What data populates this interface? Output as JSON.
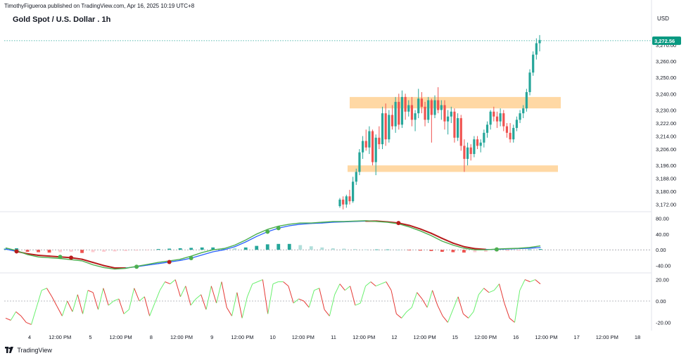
{
  "header": {
    "published": "TimothyFigueroa published on TradingView.com, Apr 16, 2025 10:19 UTC+8",
    "symbol_title": "Gold Spot / U.S. Dollar . 1h",
    "currency": "USD"
  },
  "footer": {
    "brand": "TradingView"
  },
  "colors": {
    "up": "#26a69a",
    "down": "#ef5350",
    "zone": "#ffd49a",
    "oscillator_fast": "#4caf50",
    "oscillator_slow_up": "#2962ff",
    "oscillator_slow_down": "#b71c1c",
    "hist_pos": "#26a69a",
    "hist_pos_fade": "#b2dfdb",
    "hist_neg": "#ef5350",
    "hist_neg_fade": "#ffcdd2",
    "rsi_up": "#69f06e",
    "rsi_down": "#e53935",
    "last_price_bg": "#089981"
  },
  "chart_data": [
    {
      "type": "candlestick",
      "title": "Gold Spot / U.S. Dollar . 1h",
      "ylim": [
        3168,
        3282
      ],
      "y_ticks": [
        "3,172.00",
        "3,180.00",
        "3,188.00",
        "3,196.00",
        "3,206.00",
        "3,214.00",
        "3,222.00",
        "3,230.00",
        "3,240.00",
        "3,250.00",
        "3,260.00",
        "3,270.00"
      ],
      "last_price": "3,272.56",
      "x_ticks": [
        "4",
        "12:00 PM",
        "5",
        "12:00 PM",
        "8",
        "12:00 PM",
        "9",
        "12:00 PM",
        "10",
        "12:00 PM",
        "11",
        "12:00 PM",
        "12",
        "12:00 PM",
        "15",
        "12:00 PM",
        "16",
        "12:00 PM",
        "17",
        "12:00 PM",
        "18"
      ],
      "zones": [
        {
          "low": 3231,
          "high": 3238
        },
        {
          "low": 3192,
          "high": 3196
        }
      ],
      "candles": [
        [
          3171,
          3176,
          3170,
          3175
        ],
        [
          3175,
          3177,
          3169,
          3172
        ],
        [
          3172,
          3178,
          3170,
          3177
        ],
        [
          3177,
          3181,
          3172,
          3174
        ],
        [
          3174,
          3189,
          3173,
          3186
        ],
        [
          3186,
          3194,
          3184,
          3192
        ],
        [
          3192,
          3206,
          3190,
          3204
        ],
        [
          3204,
          3214,
          3200,
          3211
        ],
        [
          3211,
          3218,
          3205,
          3207
        ],
        [
          3207,
          3220,
          3203,
          3217
        ],
        [
          3217,
          3218,
          3196,
          3198
        ],
        [
          3198,
          3215,
          3190,
          3213
        ],
        [
          3213,
          3220,
          3206,
          3209
        ],
        [
          3209,
          3232,
          3206,
          3228
        ],
        [
          3228,
          3234,
          3208,
          3212
        ],
        [
          3212,
          3230,
          3210,
          3227
        ],
        [
          3227,
          3233,
          3218,
          3220
        ],
        [
          3220,
          3238,
          3216,
          3235
        ],
        [
          3235,
          3240,
          3218,
          3221
        ],
        [
          3221,
          3242,
          3219,
          3238
        ],
        [
          3238,
          3240,
          3224,
          3229
        ],
        [
          3229,
          3236,
          3226,
          3233
        ],
        [
          3233,
          3238,
          3220,
          3224
        ],
        [
          3224,
          3230,
          3217,
          3228
        ],
        [
          3228,
          3243,
          3225,
          3237
        ],
        [
          3237,
          3241,
          3228,
          3232
        ],
        [
          3232,
          3235,
          3220,
          3224
        ],
        [
          3224,
          3238,
          3222,
          3236
        ],
        [
          3236,
          3237,
          3210,
          3227
        ],
        [
          3227,
          3239,
          3225,
          3236
        ],
        [
          3236,
          3244,
          3228,
          3230
        ],
        [
          3230,
          3236,
          3224,
          3233
        ],
        [
          3233,
          3236,
          3218,
          3223
        ],
        [
          3223,
          3230,
          3215,
          3226
        ],
        [
          3226,
          3232,
          3222,
          3229
        ],
        [
          3229,
          3231,
          3210,
          3213
        ],
        [
          3213,
          3228,
          3211,
          3225
        ],
        [
          3225,
          3227,
          3205,
          3208
        ],
        [
          3208,
          3212,
          3192,
          3200
        ],
        [
          3200,
          3210,
          3196,
          3207
        ],
        [
          3207,
          3209,
          3199,
          3203
        ],
        [
          3203,
          3214,
          3201,
          3212
        ],
        [
          3212,
          3214,
          3206,
          3208
        ],
        [
          3208,
          3212,
          3204,
          3210
        ],
        [
          3210,
          3218,
          3207,
          3216
        ],
        [
          3216,
          3223,
          3213,
          3221
        ],
        [
          3221,
          3230,
          3218,
          3229
        ],
        [
          3229,
          3232,
          3223,
          3226
        ],
        [
          3226,
          3229,
          3219,
          3223
        ],
        [
          3223,
          3231,
          3220,
          3228
        ],
        [
          3228,
          3230,
          3217,
          3220
        ],
        [
          3220,
          3222,
          3213,
          3216
        ],
        [
          3216,
          3222,
          3210,
          3212
        ],
        [
          3212,
          3221,
          3210,
          3219
        ],
        [
          3219,
          3226,
          3217,
          3224
        ],
        [
          3224,
          3230,
          3222,
          3228
        ],
        [
          3228,
          3233,
          3225,
          3231
        ],
        [
          3231,
          3243,
          3229,
          3241
        ],
        [
          3241,
          3255,
          3239,
          3253
        ],
        [
          3253,
          3266,
          3251,
          3264
        ],
        [
          3264,
          3274,
          3261,
          3271
        ],
        [
          3271,
          3276,
          3266,
          3273
        ]
      ]
    },
    {
      "type": "line",
      "ylim": [
        -55,
        95
      ],
      "y_ticks": [
        "80.00",
        "40.00",
        "0.00",
        "-40.00"
      ],
      "series": [
        {
          "values": [
            5,
            -2,
            -12,
            -18,
            -20,
            -22,
            -25,
            -28,
            -38,
            -45,
            -49,
            -47,
            -42,
            -37,
            -32,
            -28,
            -24,
            -16,
            -7,
            0,
            3,
            12,
            25,
            40,
            52,
            60,
            65,
            68,
            68,
            70,
            72,
            72,
            73,
            74,
            72,
            70,
            66,
            58,
            48,
            36,
            22,
            12,
            4,
            0,
            0,
            2,
            3,
            4,
            6,
            10
          ]
        },
        {
          "values": [
            2,
            -4,
            -10,
            -14,
            -16,
            -18,
            -20,
            -24,
            -32,
            -40,
            -46,
            -46,
            -43,
            -39,
            -35,
            -31,
            -27,
            -21,
            -13,
            -5,
            0,
            8,
            20,
            34,
            46,
            55,
            61,
            65,
            67,
            68,
            70,
            71,
            72,
            73,
            73,
            71,
            68,
            62,
            53,
            42,
            29,
            17,
            8,
            3,
            1,
            1,
            2,
            3,
            4,
            6
          ]
        }
      ],
      "histogram": [
        3,
        4,
        -5,
        -6,
        -7,
        -6,
        -5,
        -8,
        -6,
        -5,
        -4,
        -3,
        -2,
        -1,
        2,
        3,
        4,
        5,
        6,
        6,
        5,
        4,
        6,
        10,
        14,
        15,
        15,
        12,
        9,
        6,
        4,
        3,
        2,
        1,
        1,
        1,
        0,
        -1,
        -2,
        -3,
        -5,
        -6,
        -7,
        -6,
        -5,
        -4,
        -3,
        -2,
        1,
        2
      ],
      "signals": [
        {
          "i": 1,
          "kind": "down"
        },
        {
          "i": 5,
          "kind": "up"
        },
        {
          "i": 6,
          "kind": "down"
        },
        {
          "i": 12,
          "kind": "up"
        },
        {
          "i": 15,
          "kind": "down"
        },
        {
          "i": 17,
          "kind": "up"
        },
        {
          "i": 24,
          "kind": "up"
        },
        {
          "i": 25,
          "kind": "up"
        },
        {
          "i": 36,
          "kind": "down"
        },
        {
          "i": 45,
          "kind": "up"
        }
      ]
    },
    {
      "type": "line",
      "ylim": [
        -25,
        25
      ],
      "y_ticks": [
        "20.00",
        "0.00",
        "-20.00"
      ],
      "series": [
        {
          "values": [
            -16,
            -18,
            -10,
            -14,
            -20,
            -22,
            -6,
            10,
            12,
            4,
            -5,
            -14,
            0,
            -10,
            6,
            -12,
            10,
            8,
            -8,
            12,
            -4,
            0,
            2,
            -12,
            -8,
            12,
            0,
            4,
            -14,
            -2,
            10,
            18,
            16,
            20,
            4,
            14,
            -4,
            2,
            6,
            -8,
            14,
            -2,
            18,
            -6,
            -14,
            8,
            -16,
            4,
            16,
            18,
            20,
            -12,
            16,
            18,
            18,
            14,
            -2,
            2,
            0,
            -6,
            10,
            12,
            -8,
            -14,
            6,
            16,
            10,
            14,
            -4,
            -2,
            14,
            18,
            14,
            16,
            18,
            10,
            -12,
            -16,
            -10,
            -6,
            8,
            2,
            -6,
            10,
            -4,
            -14,
            -20,
            -8,
            4,
            -12,
            -16,
            -10,
            6,
            12,
            8,
            10,
            16,
            -2,
            -16,
            -20,
            10,
            20,
            18,
            20,
            16
          ]
        }
      ]
    }
  ]
}
